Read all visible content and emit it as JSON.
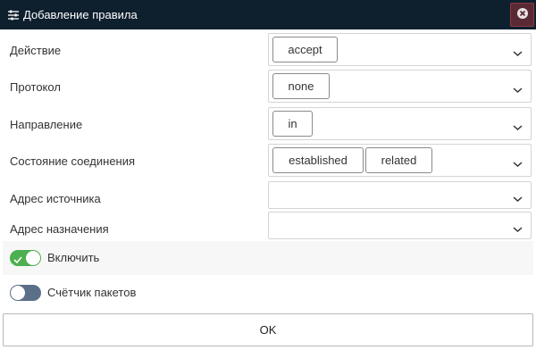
{
  "dialog": {
    "title": "Добавление правила",
    "title_icon": "tune-icon",
    "close_icon": "close-icon"
  },
  "form": {
    "action": {
      "label": "Действие",
      "chips": [
        "accept"
      ]
    },
    "protocol": {
      "label": "Протокол",
      "chips": [
        "none"
      ]
    },
    "direction": {
      "label": "Направление",
      "chips": [
        "in"
      ]
    },
    "state": {
      "label": "Состояние соединения",
      "chips": [
        "established",
        "related"
      ]
    },
    "source": {
      "label": "Адрес источника",
      "value": ""
    },
    "destination": {
      "label": "Адрес назначения",
      "value": ""
    },
    "enable": {
      "label": "Включить",
      "checked": true
    },
    "counter": {
      "label": "Счётчик пакетов",
      "checked": false
    }
  },
  "ok_label": "OK",
  "colors": {
    "titlebar": "#0e1f2e",
    "toggle_on": "#4caf50",
    "toggle_off": "#5b6f88",
    "close_bg": "#5a2a34"
  }
}
